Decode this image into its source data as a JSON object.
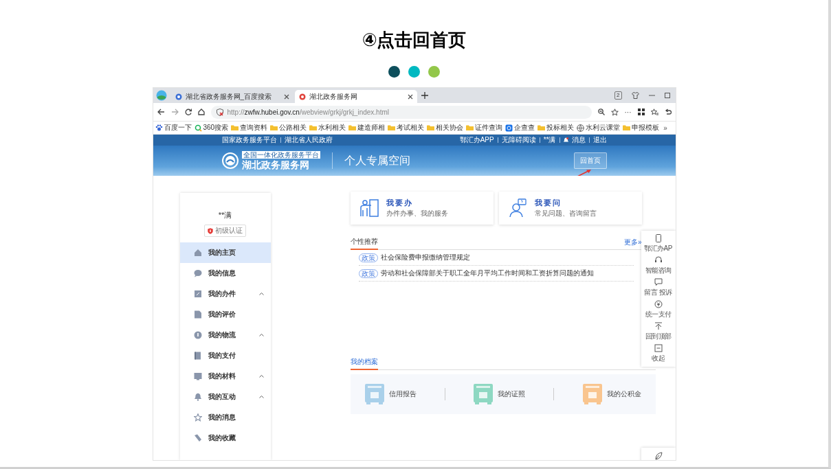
{
  "slide": {
    "title": "④点击回首页",
    "dots": [
      {
        "color": "#0d4f5c"
      },
      {
        "color": "#00b9c1"
      },
      {
        "color": "#93c74a"
      }
    ]
  },
  "browser": {
    "tabs": [
      {
        "title": "湖北省政务服务网_百度搜索",
        "selected": false
      },
      {
        "title": "湖北政务服务网",
        "selected": true
      }
    ],
    "tab_count": "2",
    "url": "http://**zwfw.hubei.gov.cn**/webview/grkj/grkj_index.html",
    "more": "···",
    "bookmarks": [
      {
        "label": "百度一下",
        "kind": "paw"
      },
      {
        "label": "360搜索",
        "kind": "search"
      },
      {
        "label": "查询资料",
        "kind": "folder"
      },
      {
        "label": "公路相关",
        "kind": "folder"
      },
      {
        "label": "水利相关",
        "kind": "folder"
      },
      {
        "label": "建造师相",
        "kind": "folder"
      },
      {
        "label": "考试相关",
        "kind": "folder"
      },
      {
        "label": "相关协会",
        "kind": "folder"
      },
      {
        "label": "证件查询",
        "kind": "folder"
      },
      {
        "label": "企查查",
        "kind": "app"
      },
      {
        "label": "投标相关",
        "kind": "folder"
      },
      {
        "label": "水利云课堂",
        "kind": "globe"
      },
      {
        "label": "申报模板",
        "kind": "folder"
      }
    ],
    "overflow": "»"
  },
  "site": {
    "top_links_left": [
      "国家政务服务平台",
      "湖北省人民政府"
    ],
    "top_links_right": [
      "鄂汇办APP",
      "无障碍阅读",
      "**满",
      "消息",
      "退出"
    ],
    "logo_tagline": "全国一体化政务服务平台",
    "logo_name": "湖北政务服务网",
    "space_title": "个人专属空间",
    "home_button": "回首页"
  },
  "sidebar": {
    "user_name": "**满",
    "verify_badge": "初级认证",
    "items": [
      {
        "label": "我的主页",
        "selected": true,
        "expandable": false
      },
      {
        "label": "我的信息",
        "selected": false,
        "expandable": false
      },
      {
        "label": "我的办件",
        "selected": false,
        "expandable": true
      },
      {
        "label": "我的评价",
        "selected": false,
        "expandable": false
      },
      {
        "label": "我的物流",
        "selected": false,
        "expandable": true
      },
      {
        "label": "我的支付",
        "selected": false,
        "expandable": false
      },
      {
        "label": "我的材料",
        "selected": false,
        "expandable": true
      },
      {
        "label": "我的互动",
        "selected": false,
        "expandable": true
      },
      {
        "label": "我的消息",
        "selected": false,
        "expandable": false
      },
      {
        "label": "我的收藏",
        "selected": false,
        "expandable": false
      }
    ]
  },
  "quick_actions": [
    {
      "title": "我要办",
      "subtitle": "办件办事、我的服务"
    },
    {
      "title": "我要问",
      "subtitle": "常见问题、咨询留言"
    }
  ],
  "recommend": {
    "heading": "个性推荐",
    "more": "更多»",
    "items": [
      {
        "tag": "政策",
        "text": "社会保险费申报缴纳管理规定"
      },
      {
        "tag": "政策",
        "text": "劳动和社会保障部关于职工全年月平均工作时间和工资折算问题的通知"
      }
    ]
  },
  "archive": {
    "heading": "我的档案",
    "items": [
      {
        "label": "信用报告",
        "color": "#a9d0ea"
      },
      {
        "label": "我的证照",
        "color": "#8ed8c2"
      },
      {
        "label": "我的公积金",
        "color": "#f9c58f"
      }
    ]
  },
  "float_panel": {
    "items": [
      "鄂汇办AP",
      "智能咨询",
      "留言 投诉",
      "统一支付",
      "回到顶部",
      "收起"
    ]
  }
}
